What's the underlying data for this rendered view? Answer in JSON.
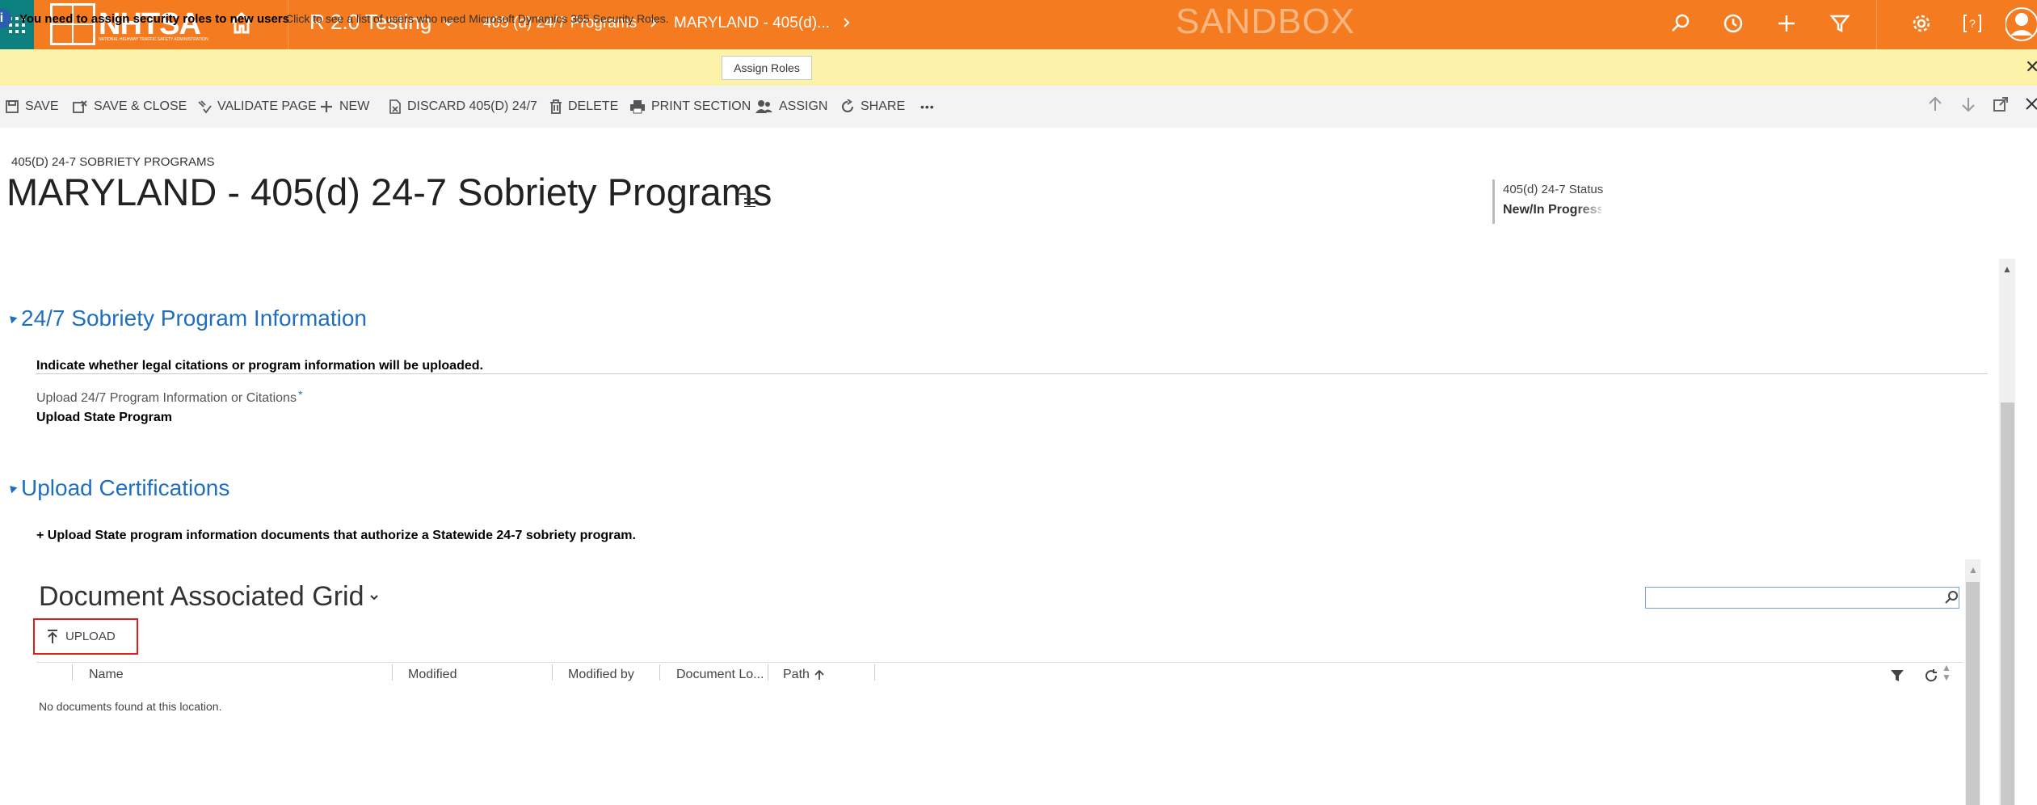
{
  "topnav": {
    "logo_text": "NHTSA",
    "logo_sub": "NATIONAL HIGHWAY TRAFFIC SAFETY ADMINISTRATION",
    "app_name": "R 2.0 Testing",
    "breadcrumb_1": "405 (d) 24/7 Programs",
    "breadcrumb_2": "MARYLAND - 405(d)...",
    "sandbox_label": "SANDBOX",
    "colors": {
      "bar": "#f47b20",
      "waffle": "#0c7f7f"
    }
  },
  "notification": {
    "bold_text": "You need to assign security roles to new users",
    "message": "Click to see a list of users who need Microsoft Dynamics 365 Security Roles.",
    "button_label": "Assign Roles",
    "close_label": "✕",
    "color": "#fdf2aa"
  },
  "commands": {
    "save": "SAVE",
    "save_close": "SAVE & CLOSE",
    "validate": "VALIDATE PAGE",
    "new": "NEW",
    "discard": "DISCARD 405(D) 24/7",
    "delete": "DELETE",
    "print": "PRINT SECTION",
    "assign": "ASSIGN",
    "share": "SHARE",
    "more": "•••"
  },
  "header": {
    "entity_type": "405(D) 24-7 SOBRIETY PROGRAMS",
    "title": "MARYLAND - 405(d) 24-7 Sobriety Programs",
    "status_label": "405(d) 24-7 Status",
    "status_value": "New/In Progress"
  },
  "section1": {
    "title": "24/7 Sobriety Program Information",
    "description": "Indicate whether legal citations or program information will be uploaded.",
    "field_label": "Upload 24/7 Program Information or Citations",
    "field_required": "*",
    "field_value": "Upload State Program"
  },
  "section2": {
    "title": "Upload Certifications",
    "description": "+ Upload State program information documents that authorize a Statewide 24-7 sobriety program."
  },
  "grid": {
    "title": "Document Associated Grid",
    "upload_label": "UPLOAD",
    "columns": [
      "Name",
      "Modified",
      "Modified by",
      "Document Lo...",
      "Path"
    ],
    "empty_message": "No documents found at this location.",
    "search_value": ""
  }
}
